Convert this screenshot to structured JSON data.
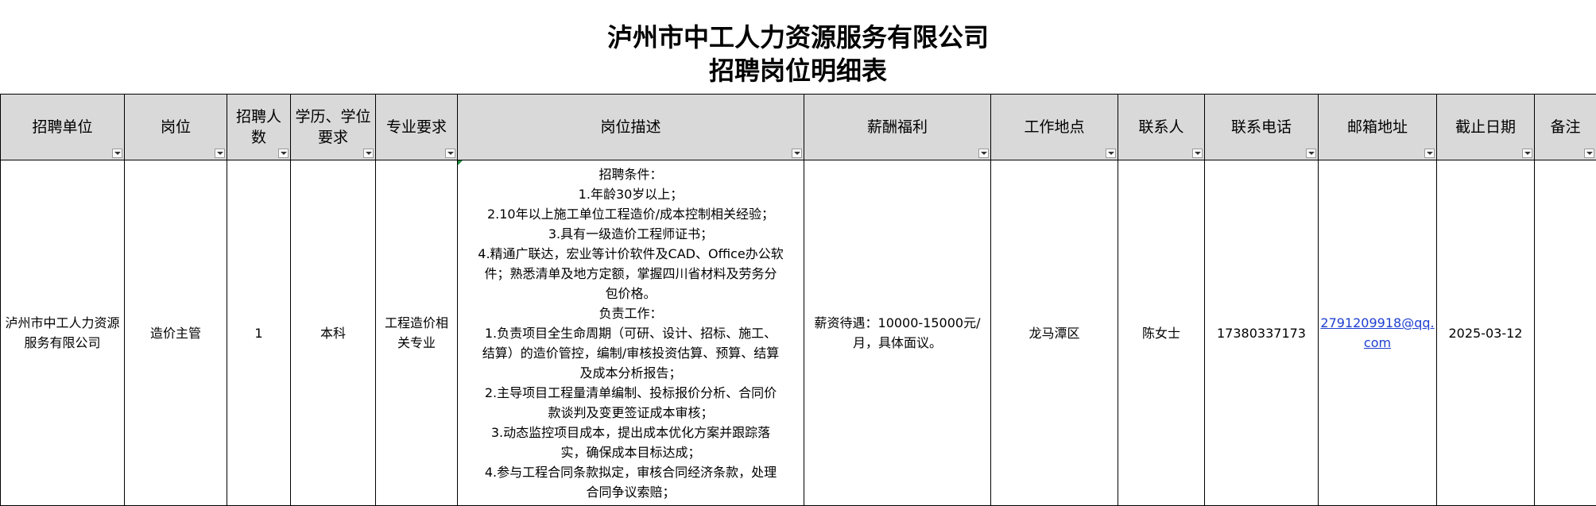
{
  "title": {
    "line1": "泸州市中工人力资源服务有限公司",
    "line2": "招聘岗位明细表"
  },
  "headers": {
    "unit": "招聘单位",
    "position": "岗位",
    "count": "招聘人数",
    "education": "学历、学位要求",
    "major": "专业要求",
    "description": "岗位描述",
    "salary": "薪酬福利",
    "location": "工作地点",
    "contact": "联系人",
    "phone": "联系电话",
    "email": "邮箱地址",
    "deadline": "截止日期",
    "remark": "备注"
  },
  "row": {
    "unit": "泸州市中工人力资源服务有限公司",
    "position": "造价主管",
    "count": "1",
    "education": "本科",
    "major": "工程造价相关专业",
    "description_lines": [
      "招聘条件：",
      "1.年龄30岁以上；",
      "2.10年以上施工单位工程造价/成本控制相关经验；",
      "3.具有一级造价工程师证书；",
      "4.精通广联达，宏业等计价软件及CAD、Office办公软",
      "件；熟悉清单及地方定额，掌握四川省材料及劳务分",
      "包价格。",
      "负责工作：",
      "1.负责项目全生命周期（可研、设计、招标、施工、",
      "结算）的造价管控，编制/审核投资估算、预算、结算",
      "及成本分析报告；",
      "2.主导项目工程量清单编制、投标报价分析、合同价",
      "款谈判及变更签证成本审核；",
      "3.动态监控项目成本，提出成本优化方案并跟踪落",
      "实，确保成本目标达成；",
      "4.参与工程合同条款拟定，审核合同经济条款，处理",
      "合同争议索赔；"
    ],
    "salary": "薪资待遇：10000-15000元/月，具体面议。",
    "location": "龙马潭区",
    "contact": "陈女士",
    "phone": "17380337173",
    "email": "2791209918@qq.com",
    "deadline": "2025-03-12",
    "remark": ""
  },
  "colors": {
    "header_bg": "#d9d9d9",
    "link": "#1f3fd0",
    "corner_indicator": "#1e8b3a"
  },
  "icons": {
    "filter": "filter-dropdown-icon"
  }
}
